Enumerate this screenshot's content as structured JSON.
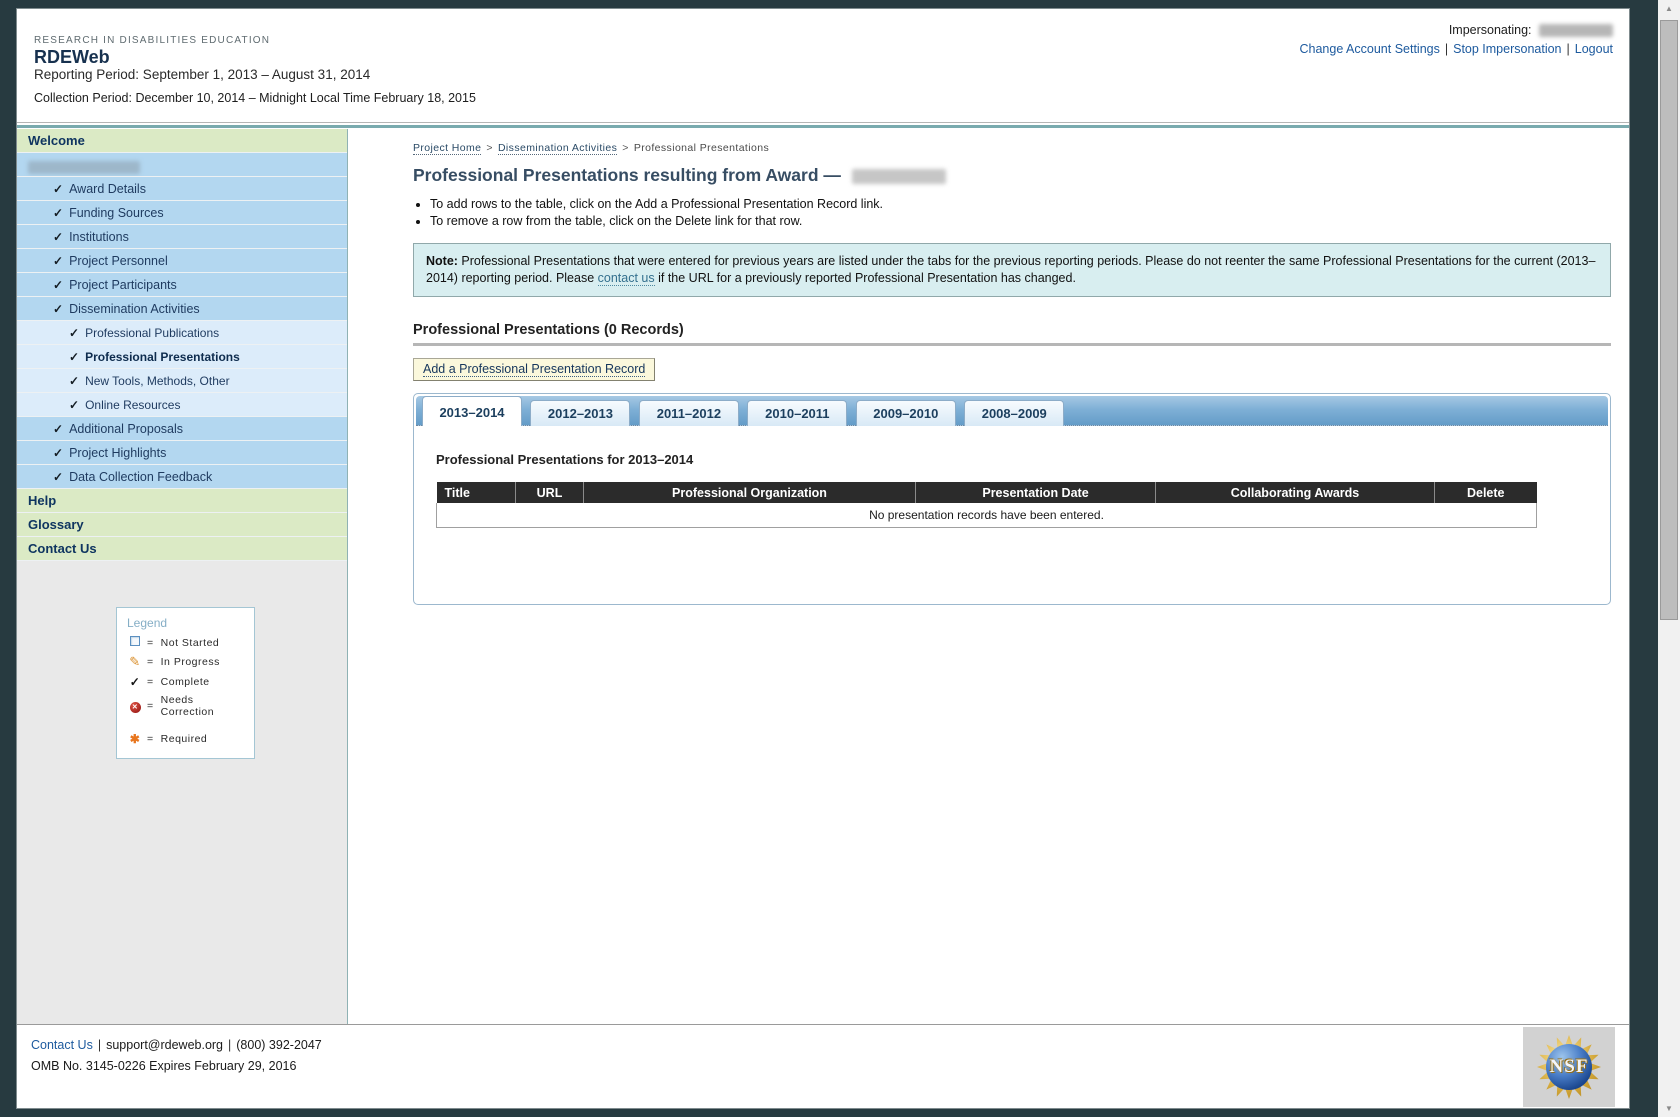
{
  "icons": {
    "check": "✓",
    "pencil": "✎",
    "error_x": "✕",
    "asterisk": "✱",
    "scroll_up": "▲",
    "scroll_down": "▼"
  },
  "misc": {
    "pipe": "|",
    "gt": ">",
    "equals": "="
  },
  "colors": {
    "accent_teal": "#79aaae",
    "sidebar_green": "#dbeac5",
    "sidebar_blue": "#b3d7f0",
    "sidebar_light_blue": "#dcecfa",
    "link_blue": "#1d5a9e",
    "note_bg": "#d8eef0",
    "table_header_bg": "#2b2b2b",
    "tab_strip_top": "#9ec4e2",
    "tab_strip_bottom": "#649cc8"
  },
  "header": {
    "eyebrow": "RESEARCH IN DISABILITIES EDUCATION",
    "app_title": "RDEWeb",
    "reporting_period": "Reporting Period: September 1, 2013 – August 31, 2014",
    "collection_period": "Collection Period: December 10, 2014 – Midnight Local Time February 18, 2015",
    "impersonating_label": "Impersonating:",
    "links": [
      {
        "label": "Change Account Settings"
      },
      {
        "label": "Stop Impersonation"
      },
      {
        "label": "Logout"
      }
    ]
  },
  "sidebar": {
    "welcome_label": "Welcome",
    "items": [
      {
        "label": "Award Details"
      },
      {
        "label": "Funding Sources"
      },
      {
        "label": "Institutions"
      },
      {
        "label": "Project Personnel"
      },
      {
        "label": "Project Participants"
      },
      {
        "label": "Dissemination Activities"
      },
      {
        "label": "Professional Publications"
      },
      {
        "label": "Professional Presentations"
      },
      {
        "label": "New Tools, Methods, Other"
      },
      {
        "label": "Online Resources"
      },
      {
        "label": "Additional Proposals"
      },
      {
        "label": "Project Highlights"
      },
      {
        "label": "Data Collection Feedback"
      }
    ],
    "sections": [
      {
        "label": "Help"
      },
      {
        "label": "Glossary"
      },
      {
        "label": "Contact Us"
      }
    ],
    "legend": {
      "title": "Legend",
      "items": [
        {
          "icon": "not-started-checkbox-icon",
          "label": "Not Started"
        },
        {
          "icon": "in-progress-pencil-icon",
          "label": "In Progress"
        },
        {
          "icon": "complete-check-icon",
          "label": "Complete"
        },
        {
          "icon": "needs-correction-icon",
          "label": "Needs Correction"
        },
        {
          "icon": "required-asterisk-icon",
          "label": "Required"
        }
      ]
    }
  },
  "main": {
    "breadcrumb": [
      {
        "label": "Project Home"
      },
      {
        "label": "Dissemination Activities"
      },
      {
        "label": "Professional Presentations"
      }
    ],
    "title": "Professional Presentations resulting from Award —",
    "bullets": [
      "To add rows to the table, click on the Add a Professional Presentation Record link.",
      "To remove a row from the table, click on the Delete link for that row."
    ],
    "note": {
      "label": "Note:",
      "text1": " Professional Presentations that were entered for previous years are listed under the tabs for the previous reporting periods. Please do not reenter the same Professional Presentations for the current (2013–2014) reporting period. Please ",
      "link": "contact us",
      "text2": " if the URL for a previously reported Professional Presentation has changed."
    },
    "section_title": "Professional Presentations (0 Records)",
    "add_button": "Add a Professional Presentation Record",
    "tabs": [
      {
        "label": "2013–2014"
      },
      {
        "label": "2012–2013"
      },
      {
        "label": "2011–2012"
      },
      {
        "label": "2010–2011"
      },
      {
        "label": "2009–2010"
      },
      {
        "label": "2008–2009"
      }
    ],
    "panel_title": "Professional Presentations for 2013–2014",
    "table": {
      "columns": [
        "Title",
        "URL",
        "Professional Organization",
        "Presentation Date",
        "Collaborating Awards",
        "Delete"
      ],
      "empty_message": "No presentation records have been entered."
    }
  },
  "footer": {
    "contact_link": "Contact Us",
    "email": "support@rdeweb.org",
    "phone": "(800) 392-2047",
    "omb_line": "OMB No. 3145-0226 Expires February 29, 2016",
    "nsf_text": "NSF"
  }
}
